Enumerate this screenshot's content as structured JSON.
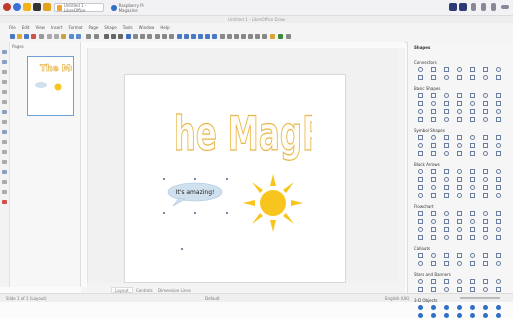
{
  "window": {
    "title": "Untitled 1 - LibreOffice Draw"
  },
  "taskbar": {
    "tasks": [
      {
        "label": "Untitled 1 - LibreOffice"
      },
      {
        "label": "Raspberry Pi Magazine"
      }
    ]
  },
  "menubar": {
    "items": [
      "File",
      "Edit",
      "View",
      "Insert",
      "Format",
      "Page",
      "Shape",
      "Tools",
      "Window",
      "Help"
    ]
  },
  "slides_panel": {
    "header": "Pages"
  },
  "canvas": {
    "headline": "The MagPi",
    "callout_text": "It's amazing!"
  },
  "sheet_tabs": [
    "Layout",
    "Controls",
    "Dimension Lines"
  ],
  "statusbar": {
    "left": "Slide 1 of 1 (Layout)",
    "mid": "Default",
    "right": "English (UK)"
  },
  "sidebar": {
    "sections": [
      "Shapes",
      "Connectors",
      "Basic Shapes",
      "Symbol Shapes",
      "Block Arrows",
      "Flowchart",
      "Callouts",
      "Stars and Banners",
      "3-D Objects"
    ]
  },
  "colors": {
    "sun": "#f7c51d",
    "headline_outline": "#e8b64a",
    "bubble_fill": "#cfe0ee",
    "accent_blue": "#2f6fc5"
  }
}
